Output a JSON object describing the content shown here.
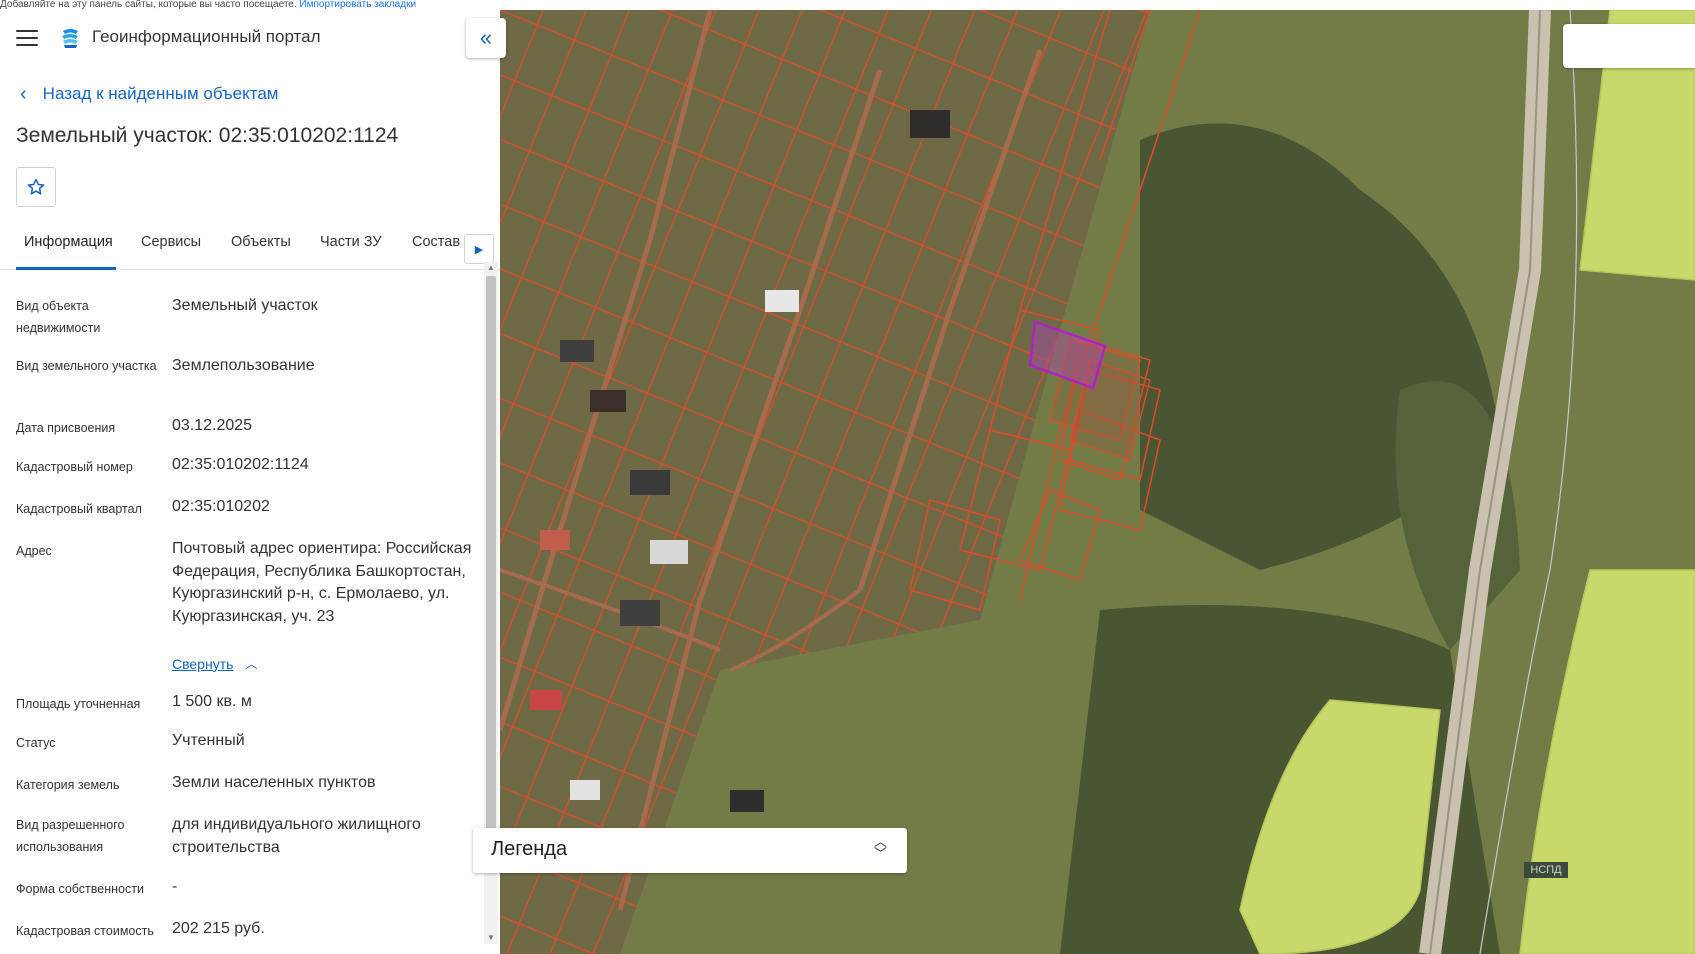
{
  "top_strip": {
    "text": "Добавляйте на эту панель сайты, которые вы часто посещаете.",
    "link": "Импортировать закладки"
  },
  "header": {
    "menu_icon": "hamburger-icon",
    "logo_icon": "portal-logo-icon",
    "title": "Геоинформационный портал"
  },
  "back_link": {
    "icon": "chevron-left-icon",
    "label": "Назад к найденным объектам"
  },
  "object_title": "Земельный участок: 02:35:010202:1124",
  "favorite_icon": "star-outline-icon",
  "tabs": [
    {
      "label": "Информация",
      "active": true
    },
    {
      "label": "Сервисы"
    },
    {
      "label": "Объекты"
    },
    {
      "label": "Части ЗУ"
    },
    {
      "label": "Состав"
    }
  ],
  "tabs_next_icon": "caret-right-icon",
  "info_rows": [
    {
      "label": "Вид объекта недвижимости",
      "value": "Земельный участок"
    },
    {
      "label": "Вид земельного участка",
      "value": "Землепользование"
    },
    {
      "label": "Дата присвоения",
      "value": "03.12.2025"
    },
    {
      "label": "Кадастровый номер",
      "value": "02:35:010202:1124"
    },
    {
      "label": "Кадастровый квартал",
      "value": "02:35:010202"
    },
    {
      "label": "Адрес",
      "value": "Почтовый адрес ориентира: Российская Федерация, Республика Башкортостан, Куюргазинский р-н, с. Ермолаево, ул. Куюргазинская, уч. 23",
      "collapse_link": "Свернуть"
    },
    {
      "label": "Площадь уточненная",
      "value": "1 500 кв. м"
    },
    {
      "label": "Статус",
      "value": "Учтенный"
    },
    {
      "label": "Категория земель",
      "value": "Земли населенных пунктов"
    },
    {
      "label": "Вид разрешенного использования",
      "value": "для индивидуального жилищного строительства"
    },
    {
      "label": "Форма собственности",
      "value": "-"
    },
    {
      "label": "Кадастровая стоимость",
      "value": "202 215 руб."
    }
  ],
  "map": {
    "collapse_icon": "double-chevron-left-icon",
    "legend_label": "Легенда",
    "legend_icon": "chevron-up-down-icon",
    "badge": "НСПД",
    "colors": {
      "parcel_border": "#e04a2a",
      "selected_parcel": "#b51fc9",
      "field": "#c9d86a",
      "forest": "#3d4a2e",
      "road": "#c9c2b0"
    }
  }
}
